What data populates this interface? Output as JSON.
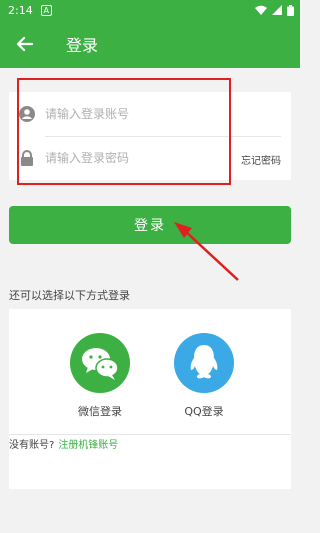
{
  "status_bar": {
    "time": "2:14",
    "notif_glyph": "A"
  },
  "app_bar": {
    "title": "登录",
    "back_icon": "arrow-left-icon"
  },
  "form": {
    "account_placeholder": "请输入登录账号",
    "password_placeholder": "请输入登录密码",
    "forgot_label": "忘记密码",
    "account_icon": "user-icon",
    "password_icon": "lock-icon"
  },
  "login_button": {
    "label": "登录"
  },
  "alt_login": {
    "title": "还可以选择以下方式登录",
    "wechat_label": "微信登录",
    "qq_label": "QQ登录"
  },
  "register": {
    "prompt": "没有账号?",
    "link": "注册机锋账号"
  },
  "colors": {
    "brand_green": "#3cb043",
    "qq_blue": "#3aa9e6",
    "annotation_red": "#e02020"
  }
}
